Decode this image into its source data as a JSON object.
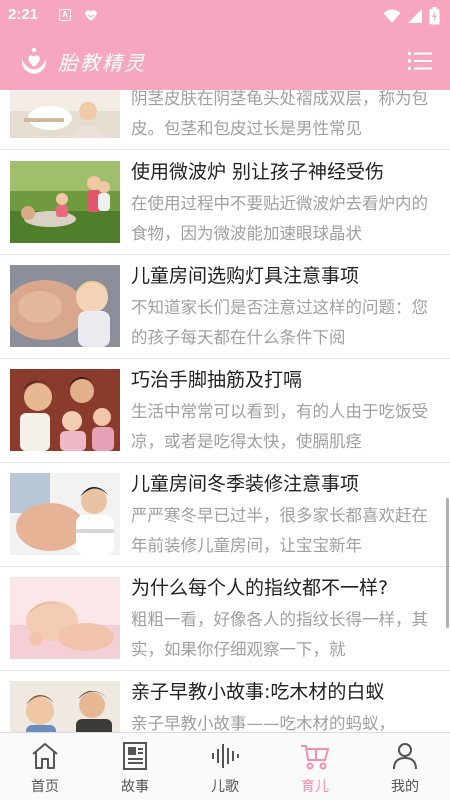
{
  "status_bar": {
    "time": "2:21",
    "notification_icons": [
      "app-a-icon",
      "heart-hands-icon"
    ],
    "system_icons": [
      "wifi-icon",
      "signal-icon",
      "battery-charging-icon"
    ]
  },
  "app_bar": {
    "title": "胎教精灵",
    "menu_icon": "list-menu-icon"
  },
  "colors": {
    "brand_pink": "#f7a6bf",
    "active_nav": "#f58fb0",
    "title_text": "#222222",
    "desc_text": "#a0a0a0"
  },
  "articles": [
    {
      "title": "",
      "desc": "阴茎皮肤在阴茎龟头处褶成双层，称为包皮。包茎和包皮过长是男性常见"
    },
    {
      "title": "使用微波炉 别让孩子神经受伤",
      "desc": "在使用过程中不要贴近微波炉去看炉内的食物，因为微波能加速眼球晶状"
    },
    {
      "title": "儿童房间选购灯具注意事项",
      "desc": "不知道家长们是否注意过这样的问题：您的孩子每天都在什么条件下阅"
    },
    {
      "title": "巧治手脚抽筋及打嗝",
      "desc": "生活中常常可以看到，有的人由于吃饭受凉，或者是吃得太快，使膈肌痉"
    },
    {
      "title": "儿童房间冬季装修注意事项",
      "desc": "严严寒冬早已过半，很多家长都喜欢赶在年前装修儿童房间，让宝宝新年"
    },
    {
      "title": "为什么每个人的指纹都不一样?",
      "desc": "粗粗一看，好像各人的指纹长得一样，其实，如果你仔细观察一下，就"
    },
    {
      "title": "亲子早教小故事:吃木材的白蚁",
      "desc": "亲子早教小故事——吃木材的蚂蚁，"
    }
  ],
  "bottom_nav": {
    "items": [
      {
        "label": "首页",
        "icon": "home-icon",
        "active": false
      },
      {
        "label": "故事",
        "icon": "book-icon",
        "active": false
      },
      {
        "label": "儿歌",
        "icon": "sound-wave-icon",
        "active": false
      },
      {
        "label": "育儿",
        "icon": "stroller-icon",
        "active": true
      },
      {
        "label": "我的",
        "icon": "person-icon",
        "active": false
      }
    ]
  }
}
